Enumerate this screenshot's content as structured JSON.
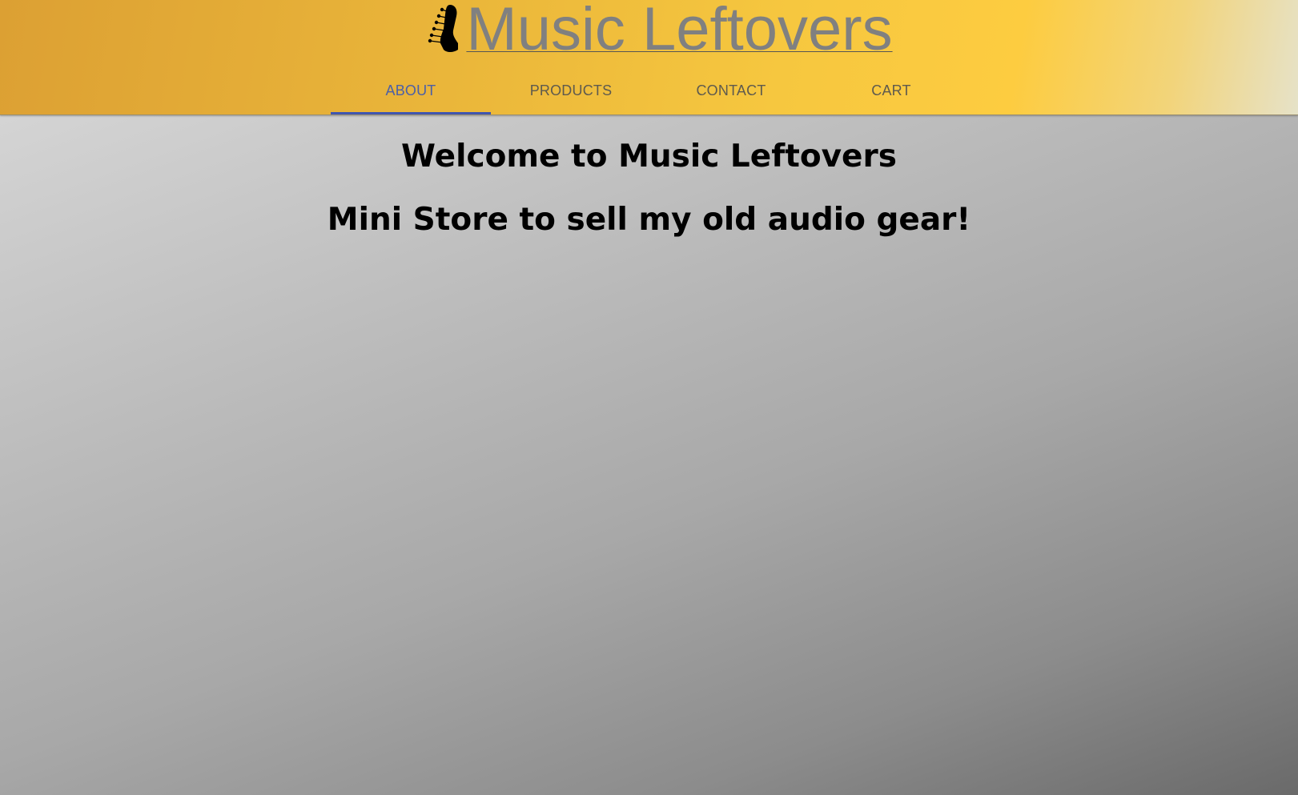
{
  "header": {
    "title": "Music Leftovers",
    "logo_icon": "guitar-headstock-icon",
    "accent_color": "#3f55b0"
  },
  "nav": {
    "tabs": [
      {
        "label": "ABOUT",
        "active": true
      },
      {
        "label": "PRODUCTS",
        "active": false
      },
      {
        "label": "CONTACT",
        "active": false
      },
      {
        "label": "CART",
        "active": false
      }
    ]
  },
  "main": {
    "heading": "Welcome to Music Leftovers",
    "subheading": "Mini Store to sell my old audio gear!"
  }
}
